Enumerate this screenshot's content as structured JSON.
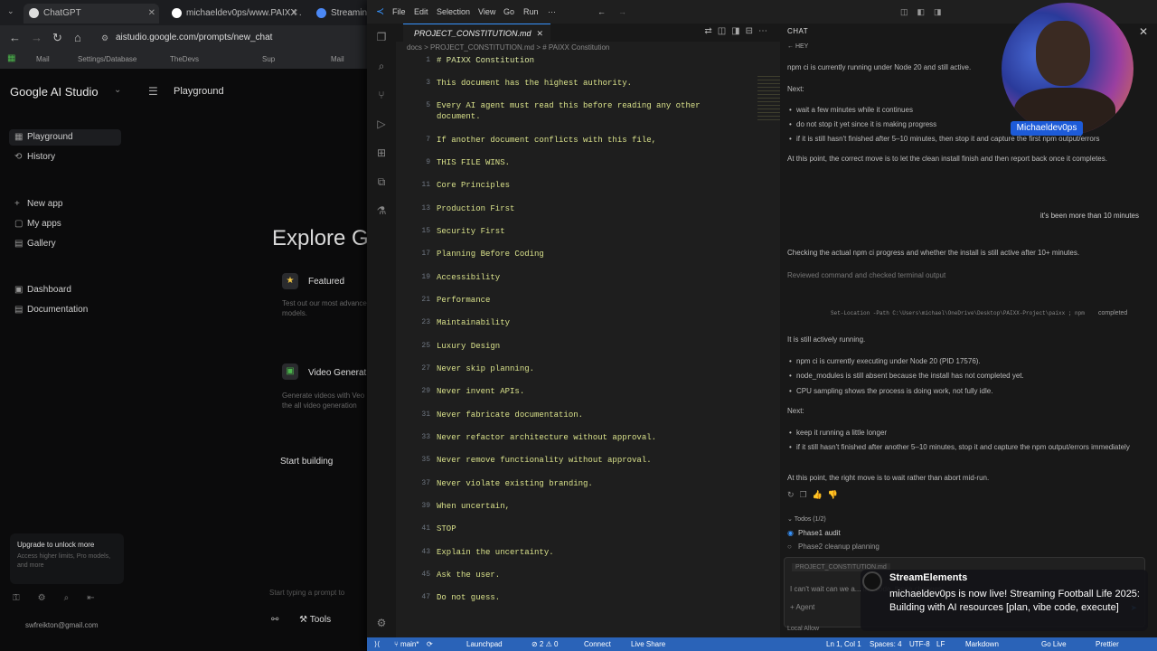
{
  "browser": {
    "tabs": [
      {
        "label": "ChatGPT",
        "color": "#1a1a1a"
      },
      {
        "label": "michaeldev0ps/www.PAIXX ...",
        "color": "#ffffff"
      },
      {
        "label": "Streaming Tok...",
        "color": "#4b88f5"
      }
    ],
    "url": "aistudio.google.com/prompts/new_chat",
    "bookmarks": [
      "Mail",
      "Settings/Database",
      "TheDevs",
      "Sup",
      "",
      "Mail",
      "Sqlit Volumes"
    ]
  },
  "studio": {
    "brand": "Google AI Studio",
    "header": "Playground",
    "section1": "",
    "nav1": [
      {
        "icon": "▦",
        "label": "Playground"
      },
      {
        "icon": "⟲",
        "label": "History"
      }
    ],
    "section2": "",
    "nav2": [
      {
        "icon": "+",
        "label": "New app"
      },
      {
        "icon": "▢",
        "label": "My apps"
      },
      {
        "icon": "▤",
        "label": "Gallery"
      }
    ],
    "section3": "",
    "nav3": [
      {
        "icon": "▣",
        "label": "Dashboard"
      },
      {
        "icon": "▤",
        "label": "Documentation"
      }
    ],
    "explore_title": "Explore Ge",
    "card1_title": "Featured",
    "card1_desc": "Test out our most advanced models.",
    "card2_title": "Video Generat",
    "card2_desc": "Generate videos with Veo the all video generation",
    "start_building": "Start building",
    "upgrade_title": "Upgrade to unlock more",
    "upgrade_desc": "Access higher limits, Pro models, and more",
    "email": "swfreikton@gmail.com",
    "prompt_hint": "Start typing a prompt to",
    "tools_label": "Tools"
  },
  "vscode": {
    "menus": [
      "File",
      "Edit",
      "Selection",
      "View",
      "Go",
      "Run",
      "···"
    ],
    "tab": "PROJECT_CONSTITUTION.md",
    "breadcrumb": "docs  >  PROJECT_CONSTITUTION.md  >  # PAIXX Constitution",
    "lines": [
      {
        "n": "1",
        "t": "# PAIXX Constitution"
      },
      {
        "n": "3",
        "t": "This document has the highest authority."
      },
      {
        "n": "5",
        "t": "Every AI agent must read this before reading any other"
      },
      {
        "n": "",
        "t": "document."
      },
      {
        "n": "7",
        "t": "If another document conflicts with this file,"
      },
      {
        "n": "9",
        "t": "THIS FILE WINS."
      },
      {
        "n": "11",
        "t": "Core Principles"
      },
      {
        "n": "13",
        "t": "Production First"
      },
      {
        "n": "15",
        "t": "Security First"
      },
      {
        "n": "17",
        "t": "Planning Before Coding"
      },
      {
        "n": "19",
        "t": "Accessibility"
      },
      {
        "n": "21",
        "t": "Performance"
      },
      {
        "n": "23",
        "t": "Maintainability"
      },
      {
        "n": "25",
        "t": "Luxury Design"
      },
      {
        "n": "27",
        "t": "Never skip planning."
      },
      {
        "n": "29",
        "t": "Never invent APIs."
      },
      {
        "n": "31",
        "t": "Never fabricate documentation."
      },
      {
        "n": "33",
        "t": "Never refactor architecture without approval."
      },
      {
        "n": "35",
        "t": "Never remove functionality without approval."
      },
      {
        "n": "37",
        "t": "Never violate existing branding."
      },
      {
        "n": "39",
        "t": "When uncertain,"
      },
      {
        "n": "41",
        "t": "STOP"
      },
      {
        "n": "43",
        "t": "Explain the uncertainty."
      },
      {
        "n": "45",
        "t": "Ask the user."
      },
      {
        "n": "47",
        "t": "Do not guess."
      }
    ],
    "chat": {
      "header": "CHAT",
      "subheader": "HEY",
      "p1": "npm ci is currently running under Node 20 and still active.",
      "next1": "Next:",
      "b1": [
        "wait a few minutes while it continues",
        "do not stop it yet since it is making progress",
        "if it is still hasn't finished after 5–10 minutes, then stop it and capture the first npm output/errors"
      ],
      "p2": "At this point, the correct move is to let the clean install finish and then report back once it completes.",
      "user1": "it's been more than 10 minutes",
      "p3": "Checking the actual npm ci progress and whether the install is still active after 10+ minutes.",
      "p4": "Reviewed command and checked terminal output",
      "cmd": "Set-Location -Path C:\\Users\\michael\\OneDrive\\Desktop\\PAIXX-Project\\paixx ; npm",
      "cmd_status": "completed",
      "p5": "It is still actively running.",
      "b2": [
        "npm ci is currently executing under Node 20 (PID 17576).",
        "node_modules is still absent because the install has not completed yet.",
        "CPU sampling shows the process is doing work, not fully idle."
      ],
      "next2": "Next:",
      "b3": [
        "keep it running a little longer",
        "if it still hasn't finished after another 5–10 minutes, stop it and capture the npm output/errors immediately"
      ],
      "p6": "At this point, the right move is to wait rather than abort mid-run.",
      "todos_head": "Todos (1/2)",
      "todos": [
        "Phase1 audit",
        "Phase2 cleanup planning"
      ],
      "input_ctx": "PROJECT_CONSTITUTION.md",
      "input_text": "I can't wait can we a... the code, these changes",
      "input_tools": "Agent",
      "foot": "Local     Allow"
    },
    "status": {
      "branch": "main*",
      "sync": "⟳",
      "launch": "Launchpad",
      "problems": "⊘ 2  ⚠ 0",
      "connect": "Connect",
      "live": "Live Share",
      "position": "Ln 1, Col 1",
      "spaces": "Spaces: 4",
      "encoding": "UTF-8",
      "eol": "LF",
      "lang": "Markdown",
      "golive": "Go Live",
      "prettier": "Prettier"
    }
  },
  "overlay": {
    "cam_name": "Michaeldev0ps",
    "notif_name": "StreamElements",
    "notif_msg": "michaeldev0ps is now live! Streaming Football Life 2025: Building with AI resources [plan, vibe code, execute]"
  }
}
